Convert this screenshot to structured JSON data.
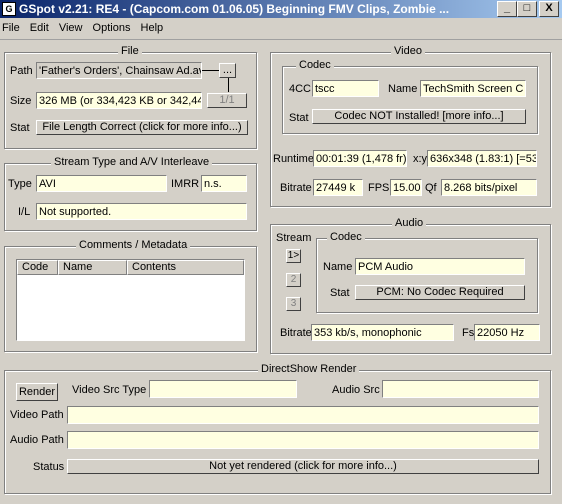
{
  "window": {
    "title": "GSpot v2.21: RE4 - (Capcom.com 01.06.05) Beginning FMV Clips, Zombie ...",
    "minimize": "_",
    "maximize": "□",
    "close": "X"
  },
  "menu": [
    "File",
    "Edit",
    "View",
    "Options",
    "Help"
  ],
  "file": {
    "legend": "File",
    "path_label": "Path",
    "path_value": "'Father's Orders', Chainsaw Ad.avi",
    "browse": "...",
    "size_label": "Size",
    "size_value": "326 MB (or 334,423 KB or 342,44",
    "size_btn": "1/1",
    "stat_label": "Stat",
    "stat_btn": "File Length Correct (click for more info...)"
  },
  "stream": {
    "legend": "Stream Type and A/V Interleave",
    "type_label": "Type",
    "type_value": "AVI",
    "imrr_label": "IMRR",
    "imrr_value": "n.s.",
    "il_label": "I/L",
    "il_value": "Not supported."
  },
  "comments": {
    "legend": "Comments / Metadata",
    "columns": [
      "Code",
      "Name",
      "Contents"
    ]
  },
  "video": {
    "legend": "Video",
    "codec_legend": "Codec",
    "fourcc_label": "4CC",
    "fourcc_value": "tscc",
    "name_label": "Name",
    "name_value": "TechSmith Screen C",
    "stat_label": "Stat",
    "stat_btn": "Codec NOT Installed!  [more info...]",
    "runtime_label": "Runtime",
    "runtime_value": "00:01:39 (1,478 fr)",
    "xy_label": "x:y",
    "xy_value": "636x348 (1.83:1) [=53",
    "bitrate_label": "Bitrate",
    "bitrate_value": "27449 k",
    "fps_label": "FPS",
    "fps_value": "15.00",
    "qf_label": "Qf",
    "qf_value": "8.268 bits/pixel"
  },
  "audio": {
    "legend": "Audio",
    "stream_label": "Stream",
    "streams": [
      "1>",
      "2",
      "3"
    ],
    "codec_legend": "Codec",
    "name_label": "Name",
    "name_value": "PCM Audio",
    "stat_label": "Stat",
    "stat_btn": "PCM: No Codec Required",
    "bitrate_label": "Bitrate",
    "bitrate_value": "353 kb/s, monophonic",
    "fs_label": "Fs",
    "fs_value": "22050 Hz"
  },
  "render": {
    "legend": "DirectShow Render",
    "render_btn": "Render",
    "video_src_type_label": "Video Src Type",
    "video_src_type_value": "",
    "audio_src_label": "Audio Src",
    "audio_src_value": "",
    "video_path_label": "Video Path",
    "video_path_value": "",
    "audio_path_label": "Audio Path",
    "audio_path_value": "",
    "status_label": "Status",
    "status_btn": "Not yet rendered (click for more info...)"
  }
}
